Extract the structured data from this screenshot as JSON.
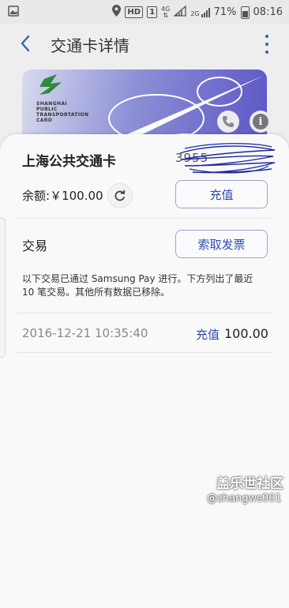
{
  "status_bar": {
    "hd": "HD",
    "sim": "1",
    "net_4g": "4G",
    "net_2g": "2G",
    "battery": "71%",
    "time": "08:16"
  },
  "app_bar": {
    "title": "交通卡详情"
  },
  "card_image": {
    "lines": [
      "SHANGHAI",
      "PUBLIC",
      "TRANSPORTATION",
      "CARD"
    ]
  },
  "card": {
    "name": "上海公共交通卡",
    "number": "3955"
  },
  "balance": {
    "label": "余额:",
    "value": "￥100.00",
    "topup_label": "充值"
  },
  "transactions": {
    "title": "交易",
    "invoice_label": "索取发票",
    "notice": "以下交易已通过 Samsung Pay 进行。下方列出了最近 10 笔交易。其他所有数据已移除。",
    "rows": [
      {
        "date": "2016-12-21",
        "time": "10:35:40",
        "type": "充值",
        "amount": "100.00"
      }
    ]
  },
  "watermark": {
    "site": "盖乐世社区",
    "user": "@zhangws001"
  },
  "colors": {
    "accent": "#2c4ea8",
    "card_blue": "#5b55c5"
  }
}
